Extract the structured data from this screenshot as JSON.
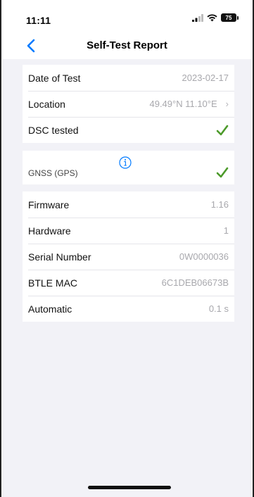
{
  "status": {
    "time": "11:11",
    "battery": "75"
  },
  "nav": {
    "title": "Self-Test Report"
  },
  "report": {
    "date_label": "Date of Test",
    "date_value": "2023-02-17",
    "location_label": "Location",
    "location_value": "49.49°N 11.10°E",
    "dsc_label": "DSC tested",
    "gnss_label": "GNSS (GPS)",
    "firmware_label": "Firmware",
    "firmware_value": "1.16",
    "hardware_label": "Hardware",
    "hardware_value": "1",
    "serial_label": "Serial Number",
    "serial_value": "0W0000036",
    "btle_label": "BTLE MAC",
    "btle_value": "6C1DEB06673B",
    "automatic_label": "Automatic",
    "automatic_value": "0.1 s"
  },
  "colors": {
    "accent": "#007aff",
    "check": "#4c9a2a",
    "background": "#f2f2f7",
    "value_text": "#a8a8ad"
  },
  "icons": {
    "back": "chevron-left-icon",
    "disclosure": "chevron-right-icon",
    "check": "checkmark-icon",
    "info": "info-circle-icon"
  }
}
